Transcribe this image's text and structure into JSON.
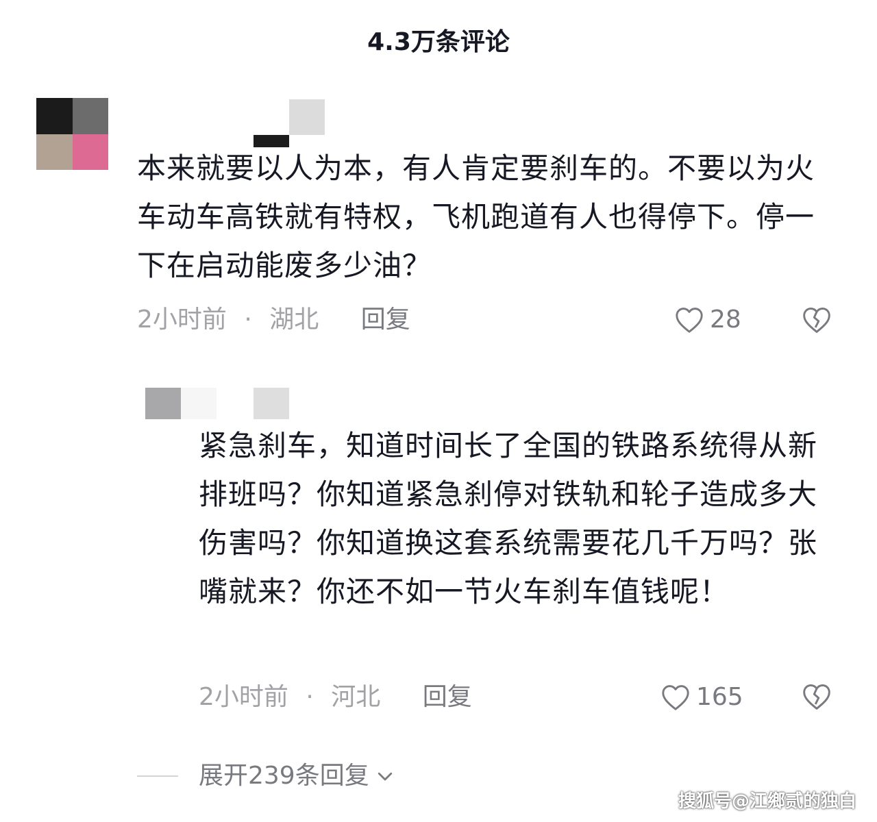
{
  "header": {
    "title": "4.3万条评论"
  },
  "comment1": {
    "text": "本来就要以人为本，有人肯定要刹车的。不要以为火车动车高铁就有特权，飞机跑道有人也得停下。停一下在启动能废多少油？",
    "time": "2小时前",
    "separator": "·",
    "location": "湖北",
    "reply_label": "回复",
    "like_count": "28"
  },
  "comment2": {
    "text": "紧急刹车，知道时间长了全国的铁路系统得从新排班吗？你知道紧急刹停对铁轨和轮子造成多大伤害吗？你知道换这套系统需要花几千万吗？张嘴就来？你还不如一节火车刹车值钱呢！",
    "time": "2小时前",
    "separator": "·",
    "location": "河北",
    "reply_label": "回复",
    "like_count": "165"
  },
  "expand": {
    "label": "展开239条回复"
  },
  "watermark": "搜狐号@江鄉贰的独白",
  "icons": {
    "like": "heart-outline-icon",
    "dislike": "broken-heart-icon",
    "expand": "chevron-down-icon"
  },
  "colors": {
    "text": "#161823",
    "meta": "#a1a1a6",
    "action": "#787a80"
  }
}
